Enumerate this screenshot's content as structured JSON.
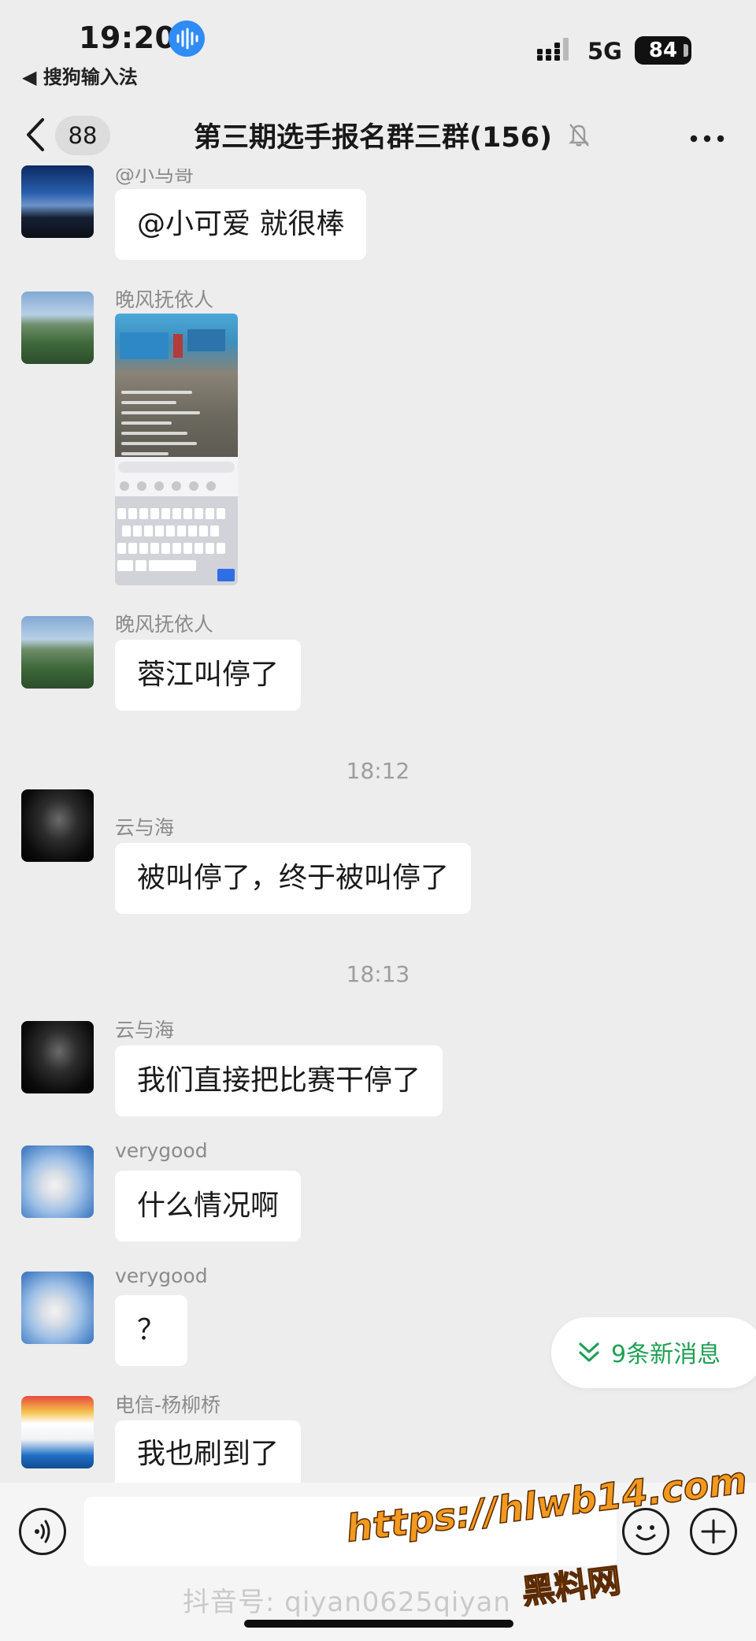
{
  "status_bar": {
    "time": "19:20",
    "back_app": "◀ 搜狗输入法",
    "network": "5G",
    "battery": "84"
  },
  "nav": {
    "unread_count": "88",
    "title": "第三期选手报名群三群(156)"
  },
  "messages": [
    {
      "sender": "@小马哥",
      "text": "@小可爱 就很棒",
      "avatar": "sky-avatar"
    },
    {
      "sender": "晚风抚依人",
      "type": "image",
      "avatar": "mountain-avatar"
    },
    {
      "sender": "晚风抚依人",
      "text": "蓉江叫停了",
      "avatar": "mountain-avatar"
    },
    {
      "timestamp": "18:12"
    },
    {
      "sender": "云与海",
      "text": "被叫停了，终于被叫停了",
      "avatar": "dark-portrait-avatar"
    },
    {
      "timestamp": "18:13"
    },
    {
      "sender": "云与海",
      "text": "我们直接把比赛干停了",
      "avatar": "dark-portrait-avatar"
    },
    {
      "sender": "verygood",
      "text": "什么情况啊",
      "avatar": "cloud-avatar"
    },
    {
      "sender": "verygood",
      "text": "？",
      "avatar": "cloud-avatar"
    },
    {
      "sender": "电信-杨柳桥",
      "text": "我也刷到了",
      "avatar": "office-avatar"
    }
  ],
  "new_messages_label": "9条新消息",
  "watermarks": {
    "douyin": "抖音号: qiyan0625qiyan",
    "url": "https://hlwb14.com",
    "site": "黑料网"
  },
  "colors": {
    "background": "#ededed",
    "bubble": "#ffffff",
    "accent_green": "#1fa055",
    "voice_blue": "#2f8cf5",
    "watermark_orange": "#f29a1f"
  }
}
